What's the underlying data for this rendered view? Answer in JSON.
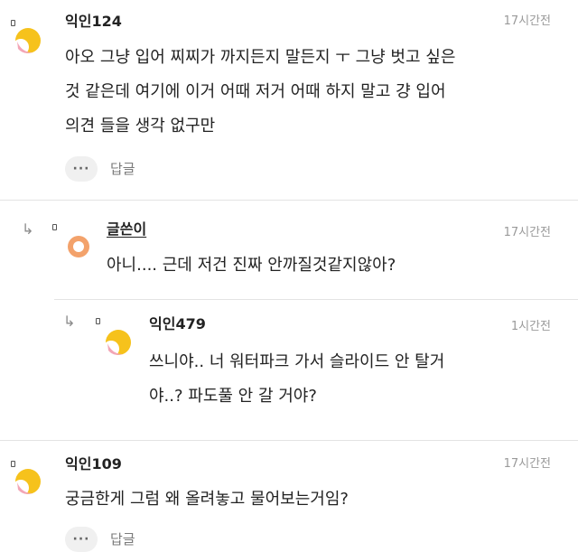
{
  "comments": [
    {
      "author": "익인124",
      "time": "17시간전",
      "lines": [
        "아오 그냥 입어 찌찌가 까지든지 말든지 ㅜ 그냥 벗고 싶은",
        "것 같은데 여기에 이거 어때 저거 어때 하지 말고 걍 입어",
        "의견 들을 생각 없구만"
      ],
      "more_label": "···",
      "reply_label": "답글",
      "avatar_icon": "moon-avatar-icon"
    },
    {
      "author": "글쓴이",
      "time": "17시간전",
      "lines": [
        "아니.... 근데 저건 진짜 안까질것같지않아?"
      ],
      "avatar_icon": "orange-ring-avatar-icon"
    },
    {
      "author": "익인479",
      "time": "1시간전",
      "lines": [
        "쓰니야.. 너 워터파크 가서 슬라이드 안 탈거",
        "야..? 파도풀 안 갈 거야?"
      ],
      "avatar_icon": "moon-avatar-icon"
    },
    {
      "author": "익인109",
      "time": "17시간전",
      "lines": [
        "궁금한게 그럼 왜 올려놓고 물어보는거임?"
      ],
      "more_label": "···",
      "reply_label": "답글",
      "avatar_icon": "moon-avatar-icon"
    }
  ],
  "icons": {
    "reply_arrow": "↳",
    "pin": "pin-icon"
  },
  "colors": {
    "moon_yellow": "#f6c21c",
    "moon_pink": "#f3a6b6",
    "ring_orange": "#f3a26b",
    "text_main": "#222222",
    "text_muted": "#9a9a9a"
  }
}
